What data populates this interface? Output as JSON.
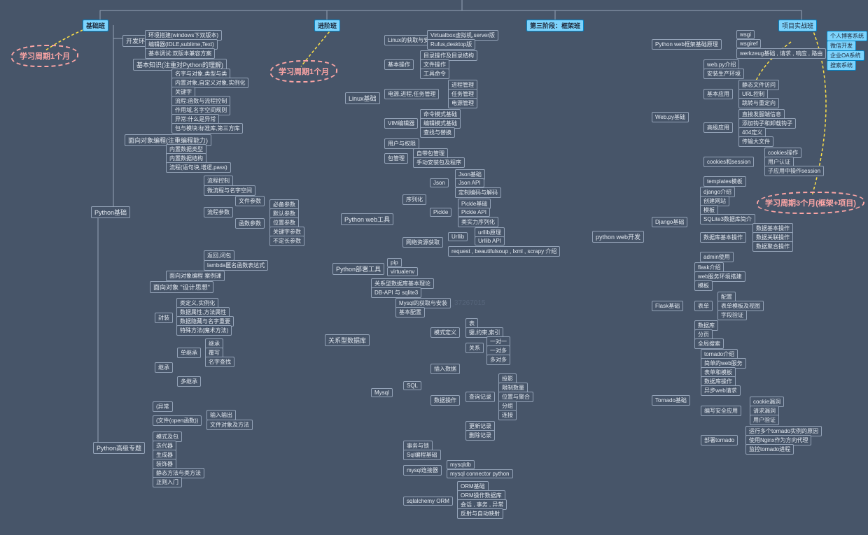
{
  "headers": {
    "basic": "基础班",
    "advanced": "进阶班",
    "stage3": "第三阶段：框架班",
    "project": "项目实战班"
  },
  "clouds": {
    "c1": "学习周期1个月",
    "c2": "学习周期1个月",
    "c3": "学习周期3个月(框架+项目)"
  },
  "watermark": "blog.csdn.net/qq_37267015",
  "b": {
    "pyBasic": "Python基础",
    "envSetup": "开发环境搭建",
    "env1": "环境搭建(windows下双版本)",
    "env2": "编辑器(IDLE,sublime,Text)",
    "env3": "基本调试:双版本兼容方案",
    "basicKnow": "基本知识(注重对Python的理解)",
    "bk1": "名字与对象,类型与类",
    "bk2": "内置对象,自定义对象,实例化",
    "bk3": "关键字",
    "bk4": "流程:函数与流程控制",
    "bk5": "作用域,名字空间规则",
    "bk6": "异常:什么是异常",
    "bk7": "包与模块:标准库,第三方库",
    "oop": "面向对象编程(注重编程能力)",
    "oop1": "内置数据类型",
    "oop2": "内置数据结构",
    "oop3": "流程(语句块,增逻,pass)",
    "fc": "流程控制",
    "fc1": "微流程与名字空间",
    "fp": "流程参数",
    "fp1": "文件参数",
    "fp2": "函数参数",
    "fp2a": "必备参数",
    "fp2b": "默认参数",
    "fp2c": "位置参数",
    "fp2d": "关键字参数",
    "fp2e": "不定长参数",
    "ret": "返回,闭包",
    "lam": "lambda匿名函数表达式",
    "oopCase": "面向对象编程 案例课",
    "design": "面向对象 \"设计思想\"",
    "cls": "封装",
    "cls1": "类定义,实例化",
    "cls2": "数据属性,方法属性",
    "cls3": "数据隐藏与名字重要",
    "cls4": "特殊方法(魔术方法)",
    "inh": "继承",
    "inh1": "单继承",
    "inh2": "多继承",
    "inh1a": "继承",
    "inh1b": "覆写",
    "inh1c": "名字查找",
    "adv": "Python高级专题",
    "adv1": "(异常",
    "adv2": "(文件(open函数))",
    "adv2a": "输入输出",
    "adv2b": "文件对象及方法",
    "adv3": "模式及包",
    "adv4": "迭代器",
    "adv5": "生成器",
    "adv6": "装饰器",
    "adv7": "静态方法与类方法",
    "adv8": "正则入门"
  },
  "a": {
    "linux": "Linux基础",
    "linuxDeploy": "Linux的获取与安装",
    "ld1": "Virtualbox虚拟机,server版",
    "ld2": "Rufus,desktop版",
    "basicOp": "基本操作",
    "bo1": "目录操作及目录结构",
    "bo2": "文件操作",
    "bo3": "工具命令",
    "proc": "电源,进程,任务管理",
    "pr1": "进程管理",
    "pr2": "任务管理",
    "pr3": "电源管理",
    "vim": "VIM编辑器",
    "vi1": "命令模式基础",
    "vi2": "编辑模式基础",
    "vi3": "查找与替换",
    "user": "用户与权限",
    "pkg": "包管理",
    "pk1": "自带包管理",
    "pk2": "手动安装包及程序",
    "webTool": "Python web工具",
    "serial": "序列化",
    "json": "Json",
    "js1": "Json基础",
    "js2": "Json API",
    "js3": "定制编码与解码",
    "pickle": "Pickle",
    "pi1": "Pickle基础",
    "pi2": "Pickle API",
    "pi3": "类实力序列化",
    "net": "网络资源获取",
    "urllib": "Urllib",
    "ur1": "urllib原理",
    "ur2": "Urllib API",
    "reqbs": "request , beautifulsoup , lxml , scrapy 介绍",
    "deploy": "Python部署工具",
    "dp1": "pip",
    "dp2": "virtualenv",
    "rdb": "关系型数据库",
    "rd1": "关系型数据库基本理论",
    "rd2": "DB-API 与 sqlite3",
    "myGet": "Mysql的获取与安装",
    "myConf": "基本配置",
    "mysql": "Mysql",
    "sql": "SQL",
    "schema": "模式定义",
    "sc1": "表",
    "sc2": "键,约束,索引",
    "rel": "关系",
    "re1": "一对一",
    "re2": "一对多",
    "re3": "多对多",
    "ins": "插入数据",
    "dop": "数据操作",
    "do1": "投影",
    "do2": "限制数量",
    "do3": "位置与聚合",
    "do4": "分组",
    "do5": "连接",
    "qry": "查询记录",
    "upd": "更新记录",
    "del": "删除记录",
    "tx": "事务与锁",
    "sqlProg": "Sql编程基础",
    "conn": "mysql连接器",
    "co1": "mysqldb",
    "co2": "mysql connector python",
    "orm": "sqlalchemy ORM",
    "or1": "ORM基础",
    "or2": "ORM操作数据库",
    "or3": "会话 , 事务 , 异常",
    "or4": "反射与自动映射"
  },
  "f": {
    "webDev": "python web开发",
    "webFrame": "Python web框架基础原理",
    "wf1": "wsgi",
    "wf2": "wsgiref",
    "wf3": "werkzeug基础 , 请求 , 响应 , 路由",
    "webpy": "Web.py基础",
    "wp1": "web.py介绍",
    "wp2": "安装生产环境",
    "bApp": "基本应用",
    "ba1": "静态文件访问",
    "ba2": "URL控制",
    "ba3": "跳转与重定向",
    "hApp": "高级应用",
    "ha1": "直接发服端信息",
    "ha2": "添加钩子和卸载钩子",
    "ha3": "404定义",
    "ha4": "传输大文件",
    "cookie": "cookies和session",
    "ck1": "cookies操作",
    "ck2": "用户认证",
    "ck3": "子应用中操作session",
    "tpl": "templates模板",
    "django": "Django基础",
    "dj1": "django介绍",
    "dj2": "创建网站",
    "dj3": "模板",
    "dj4": "SQLite3数据库简介",
    "djDb": "数据库基本操作",
    "db1": "数据基本操作",
    "db2": "数据关联操作",
    "db3": "数据聚合操作",
    "dj5": "admin使用",
    "flask": "Flask基础",
    "fl1": "flask介绍",
    "fl2": "web服务环境搭建",
    "fl3": "模板",
    "form": "表单",
    "fo1": "配置",
    "fo2": "表单模板及视图",
    "fo3": "字段验证",
    "fl4": "数据库",
    "fl5": "分页",
    "fl6": "全局搜索",
    "tornado": "Tornado基础",
    "to1": "tornado介绍",
    "to2": "简单的web服务",
    "to3": "表单和模板",
    "to4": "数据库操作",
    "to5": "异步web请求",
    "safe": "编写安全应用",
    "sa1": "cookie漏洞",
    "sa2": "请求漏洞",
    "sa3": "用户验证",
    "depTor": "部署tornado",
    "dt1": "运行多个tornado实例的原因",
    "dt2": "使用Nginx作为方向代理",
    "dt3": "监控tornado进程"
  },
  "p": {
    "p1": "个人博客系统",
    "p2": "微信开发",
    "p3": "企业OA系统",
    "p4": "搜索系统"
  }
}
